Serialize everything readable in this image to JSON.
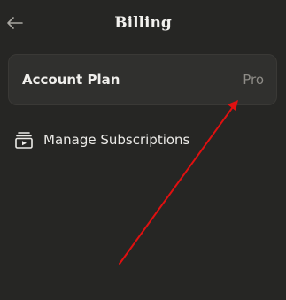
{
  "header": {
    "title": "Billing",
    "back_icon": "arrow-left-icon"
  },
  "account_plan": {
    "label": "Account Plan",
    "value": "Pro"
  },
  "manage_subscriptions": {
    "label": "Manage Subscriptions",
    "icon": "subscriptions-icon"
  },
  "colors": {
    "background": "#262624",
    "card": "#30302e",
    "muted_text": "#8e8c87",
    "annotation_arrow": "#e01010"
  }
}
